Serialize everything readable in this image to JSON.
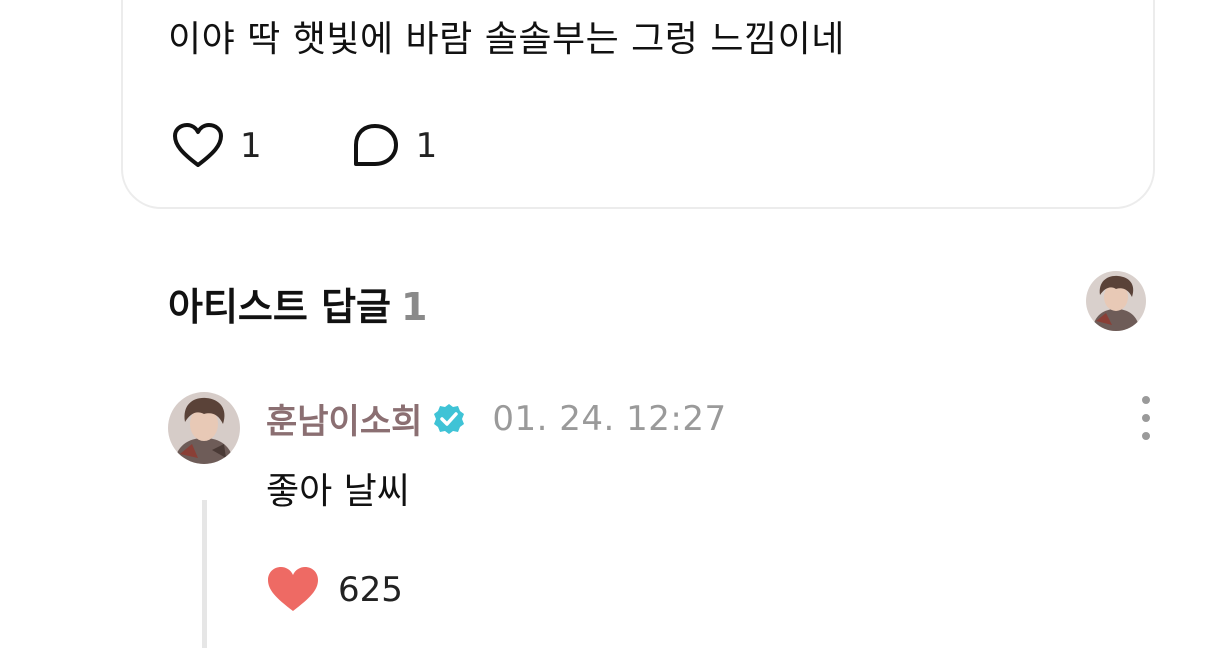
{
  "post": {
    "text": "이야 딱 햇빛에 바람 솔솔부는 그렁 느낌이네",
    "likes": "1",
    "comments": "1",
    "avatar_icon": "chick-icon"
  },
  "artist_replies": {
    "title": "아티스트 답글",
    "count": "1"
  },
  "comment": {
    "author": "훈남이소희",
    "verified_icon": "verified-badge-icon",
    "timestamp": "01. 24. 12:27",
    "text": "좋아 날씨",
    "likes": "625"
  },
  "colors": {
    "heart_filled": "#ee6a64",
    "verified": "#3fc3d6",
    "author": "#8b6f72",
    "muted": "#9a9a9a"
  }
}
